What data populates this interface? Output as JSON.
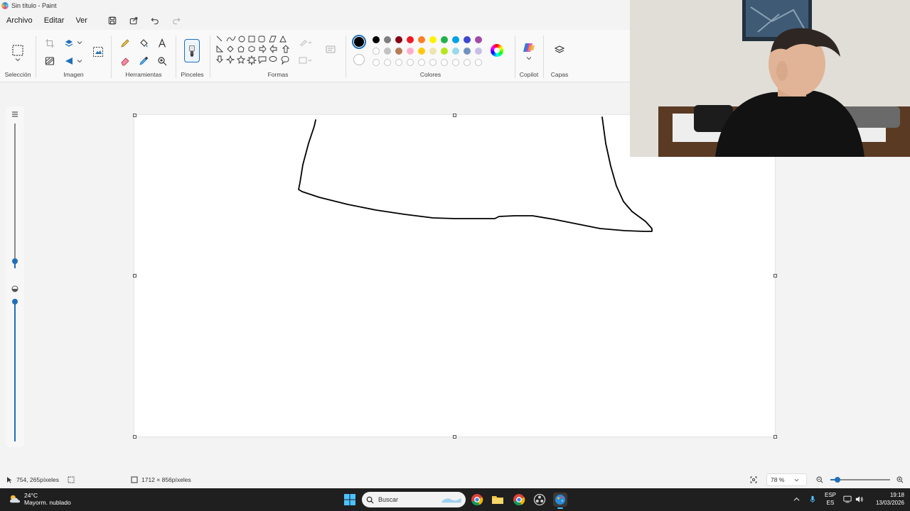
{
  "window": {
    "title": "Sin título - Paint"
  },
  "menu": {
    "file": "Archivo",
    "edit": "Editar",
    "view": "Ver"
  },
  "ribbon": {
    "groups": {
      "selection": "Selección",
      "image": "Imagen",
      "tools": "Herramientas",
      "brushes": "Pinceles",
      "shapes": "Formas",
      "colors": "Colores",
      "copilot": "Copilot",
      "layers": "Capas"
    },
    "colors": {
      "primary": "#000000",
      "secondary": "#ffffff",
      "palette_row1": [
        "#000000",
        "#7f7f7f",
        "#880015",
        "#ed1c24",
        "#ff7f27",
        "#fff200",
        "#22b14c",
        "#00a2e8",
        "#3f48cc",
        "#a349a4"
      ],
      "palette_row2": [
        "#ffffff",
        "#c3c3c3",
        "#b97a57",
        "#ffaec9",
        "#ffc90e",
        "#efe4b0",
        "#b5e61d",
        "#99d9ea",
        "#7092be",
        "#c8bfe7"
      ]
    }
  },
  "status": {
    "cursor_position": "754, 265píxeles",
    "canvas_size": "1712 × 856píxeles",
    "zoom": "78 %"
  },
  "taskbar": {
    "weather_temp": "24°C",
    "weather_desc": "Mayorm. nublado",
    "search_placeholder": "Buscar",
    "lang_top": "ESP",
    "lang_bottom": "ES",
    "time": "19:18",
    "date": "13/03/2026"
  }
}
